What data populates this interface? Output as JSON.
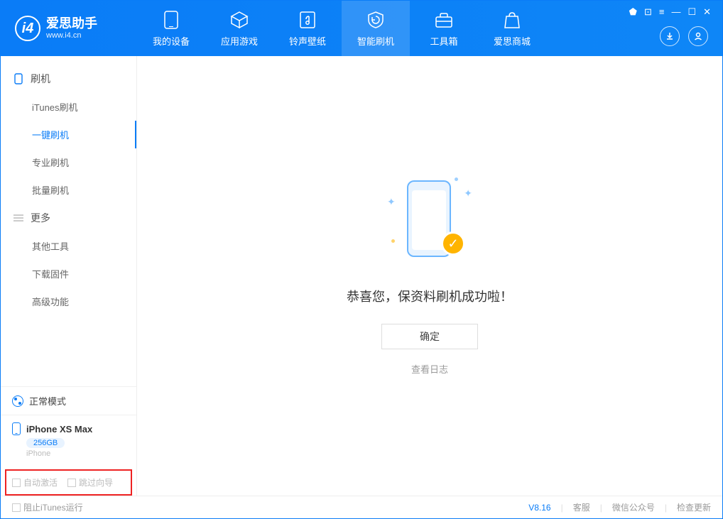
{
  "app": {
    "title": "爱思助手",
    "subtitle": "www.i4.cn"
  },
  "nav": {
    "tabs": [
      {
        "label": "我的设备"
      },
      {
        "label": "应用游戏"
      },
      {
        "label": "铃声壁纸"
      },
      {
        "label": "智能刷机"
      },
      {
        "label": "工具箱"
      },
      {
        "label": "爱思商城"
      }
    ]
  },
  "sidebar": {
    "section1": {
      "title": "刷机",
      "items": [
        {
          "label": "iTunes刷机"
        },
        {
          "label": "一键刷机"
        },
        {
          "label": "专业刷机"
        },
        {
          "label": "批量刷机"
        }
      ]
    },
    "section2": {
      "title": "更多",
      "items": [
        {
          "label": "其他工具"
        },
        {
          "label": "下载固件"
        },
        {
          "label": "高级功能"
        }
      ]
    },
    "mode": "正常模式",
    "device": {
      "name": "iPhone XS Max",
      "storage": "256GB",
      "type": "iPhone"
    },
    "options": {
      "opt1": "自动激活",
      "opt2": "跳过向导"
    }
  },
  "main": {
    "success": "恭喜您，保资料刷机成功啦！",
    "ok": "确定",
    "loglink": "查看日志"
  },
  "footer": {
    "block_itunes": "阻止iTunes运行",
    "version": "V8.16",
    "links": {
      "support": "客服",
      "wechat": "微信公众号",
      "update": "检查更新"
    }
  }
}
